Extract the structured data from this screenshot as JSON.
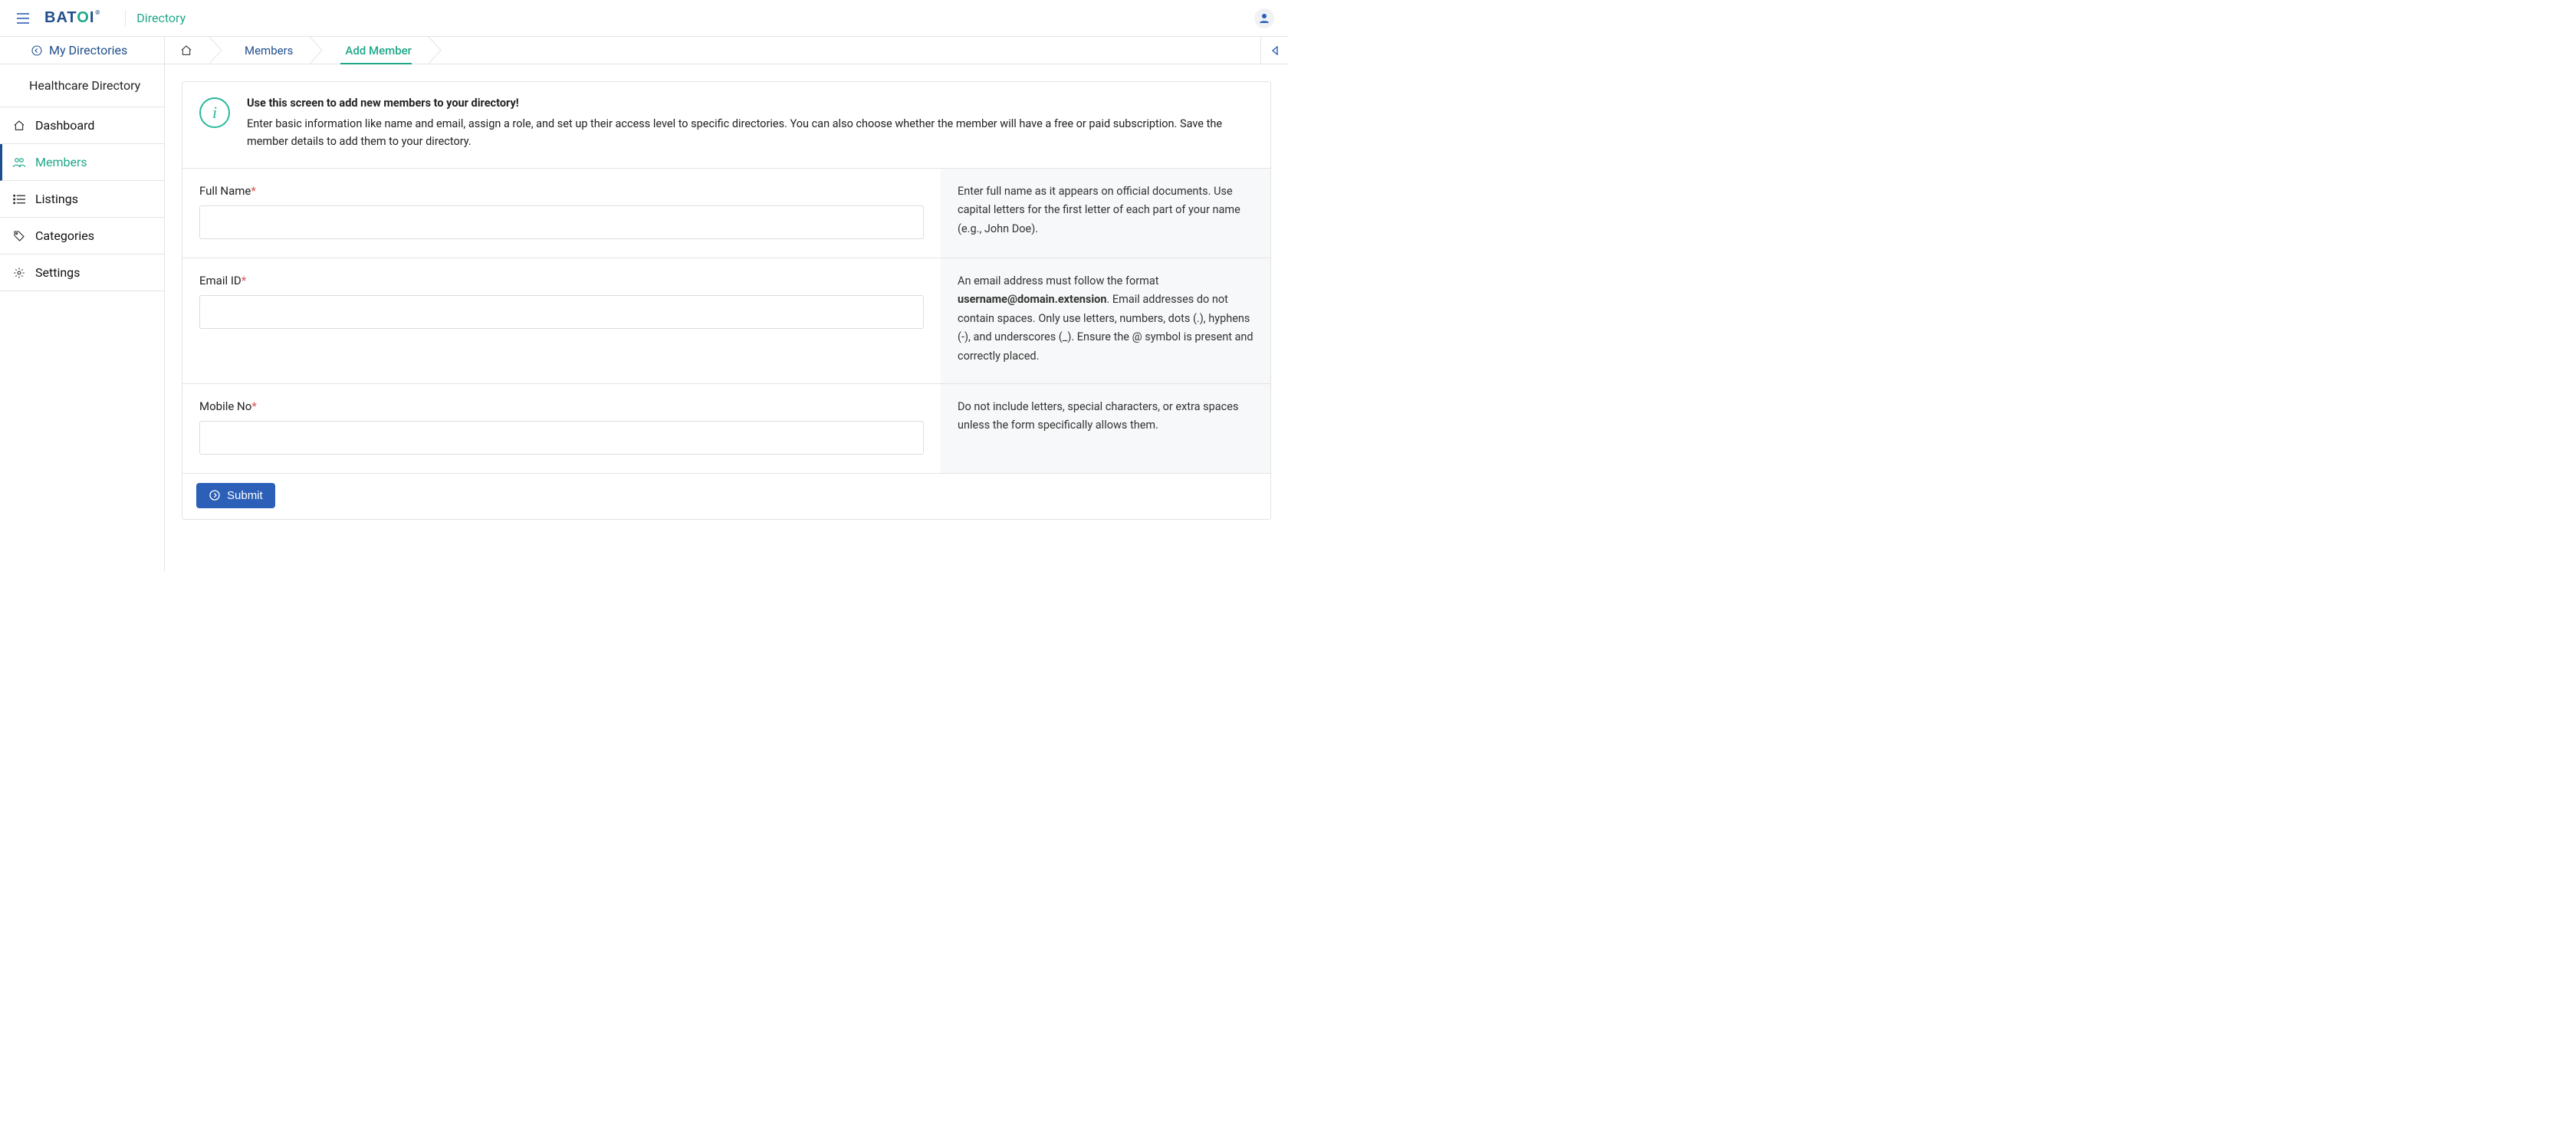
{
  "header": {
    "logo_part1": "BAT",
    "logo_accent": "O",
    "logo_part2": "I",
    "app_name": "Directory"
  },
  "subbar": {
    "back_label": "My Directories"
  },
  "breadcrumbs": {
    "members_label": "Members",
    "add_member_label": "Add Member"
  },
  "sidebar": {
    "directory_title": "Healthcare Directory",
    "items": {
      "dashboard": "Dashboard",
      "members": "Members",
      "listings": "Listings",
      "categories": "Categories",
      "settings": "Settings"
    }
  },
  "banner": {
    "title": "Use this screen to add new members to your directory!",
    "body": "Enter basic information like name and email, assign a role, and set up their access level to specific directories. You can also choose whether the member will have a free or paid subscription. Save the member details to add them to your directory."
  },
  "form": {
    "full_name": {
      "label": "Full Name",
      "value": "",
      "hint": "Enter full name as it appears on official documents. Use capital letters for the first letter of each part of your name (e.g., John Doe)."
    },
    "email": {
      "label": "Email ID",
      "value": "",
      "hint_before": "An email address must follow the format ",
      "hint_strong": "username@domain.extension",
      "hint_after": ". Email addresses do not contain spaces. Only use letters, numbers, dots (.), hyphens (-), and underscores (_). Ensure the @ symbol is present and correctly placed."
    },
    "mobile": {
      "label": "Mobile No",
      "value": "",
      "hint": "Do not include letters, special characters, or extra spaces unless the form specifically allows them."
    },
    "submit_label": "Submit"
  }
}
